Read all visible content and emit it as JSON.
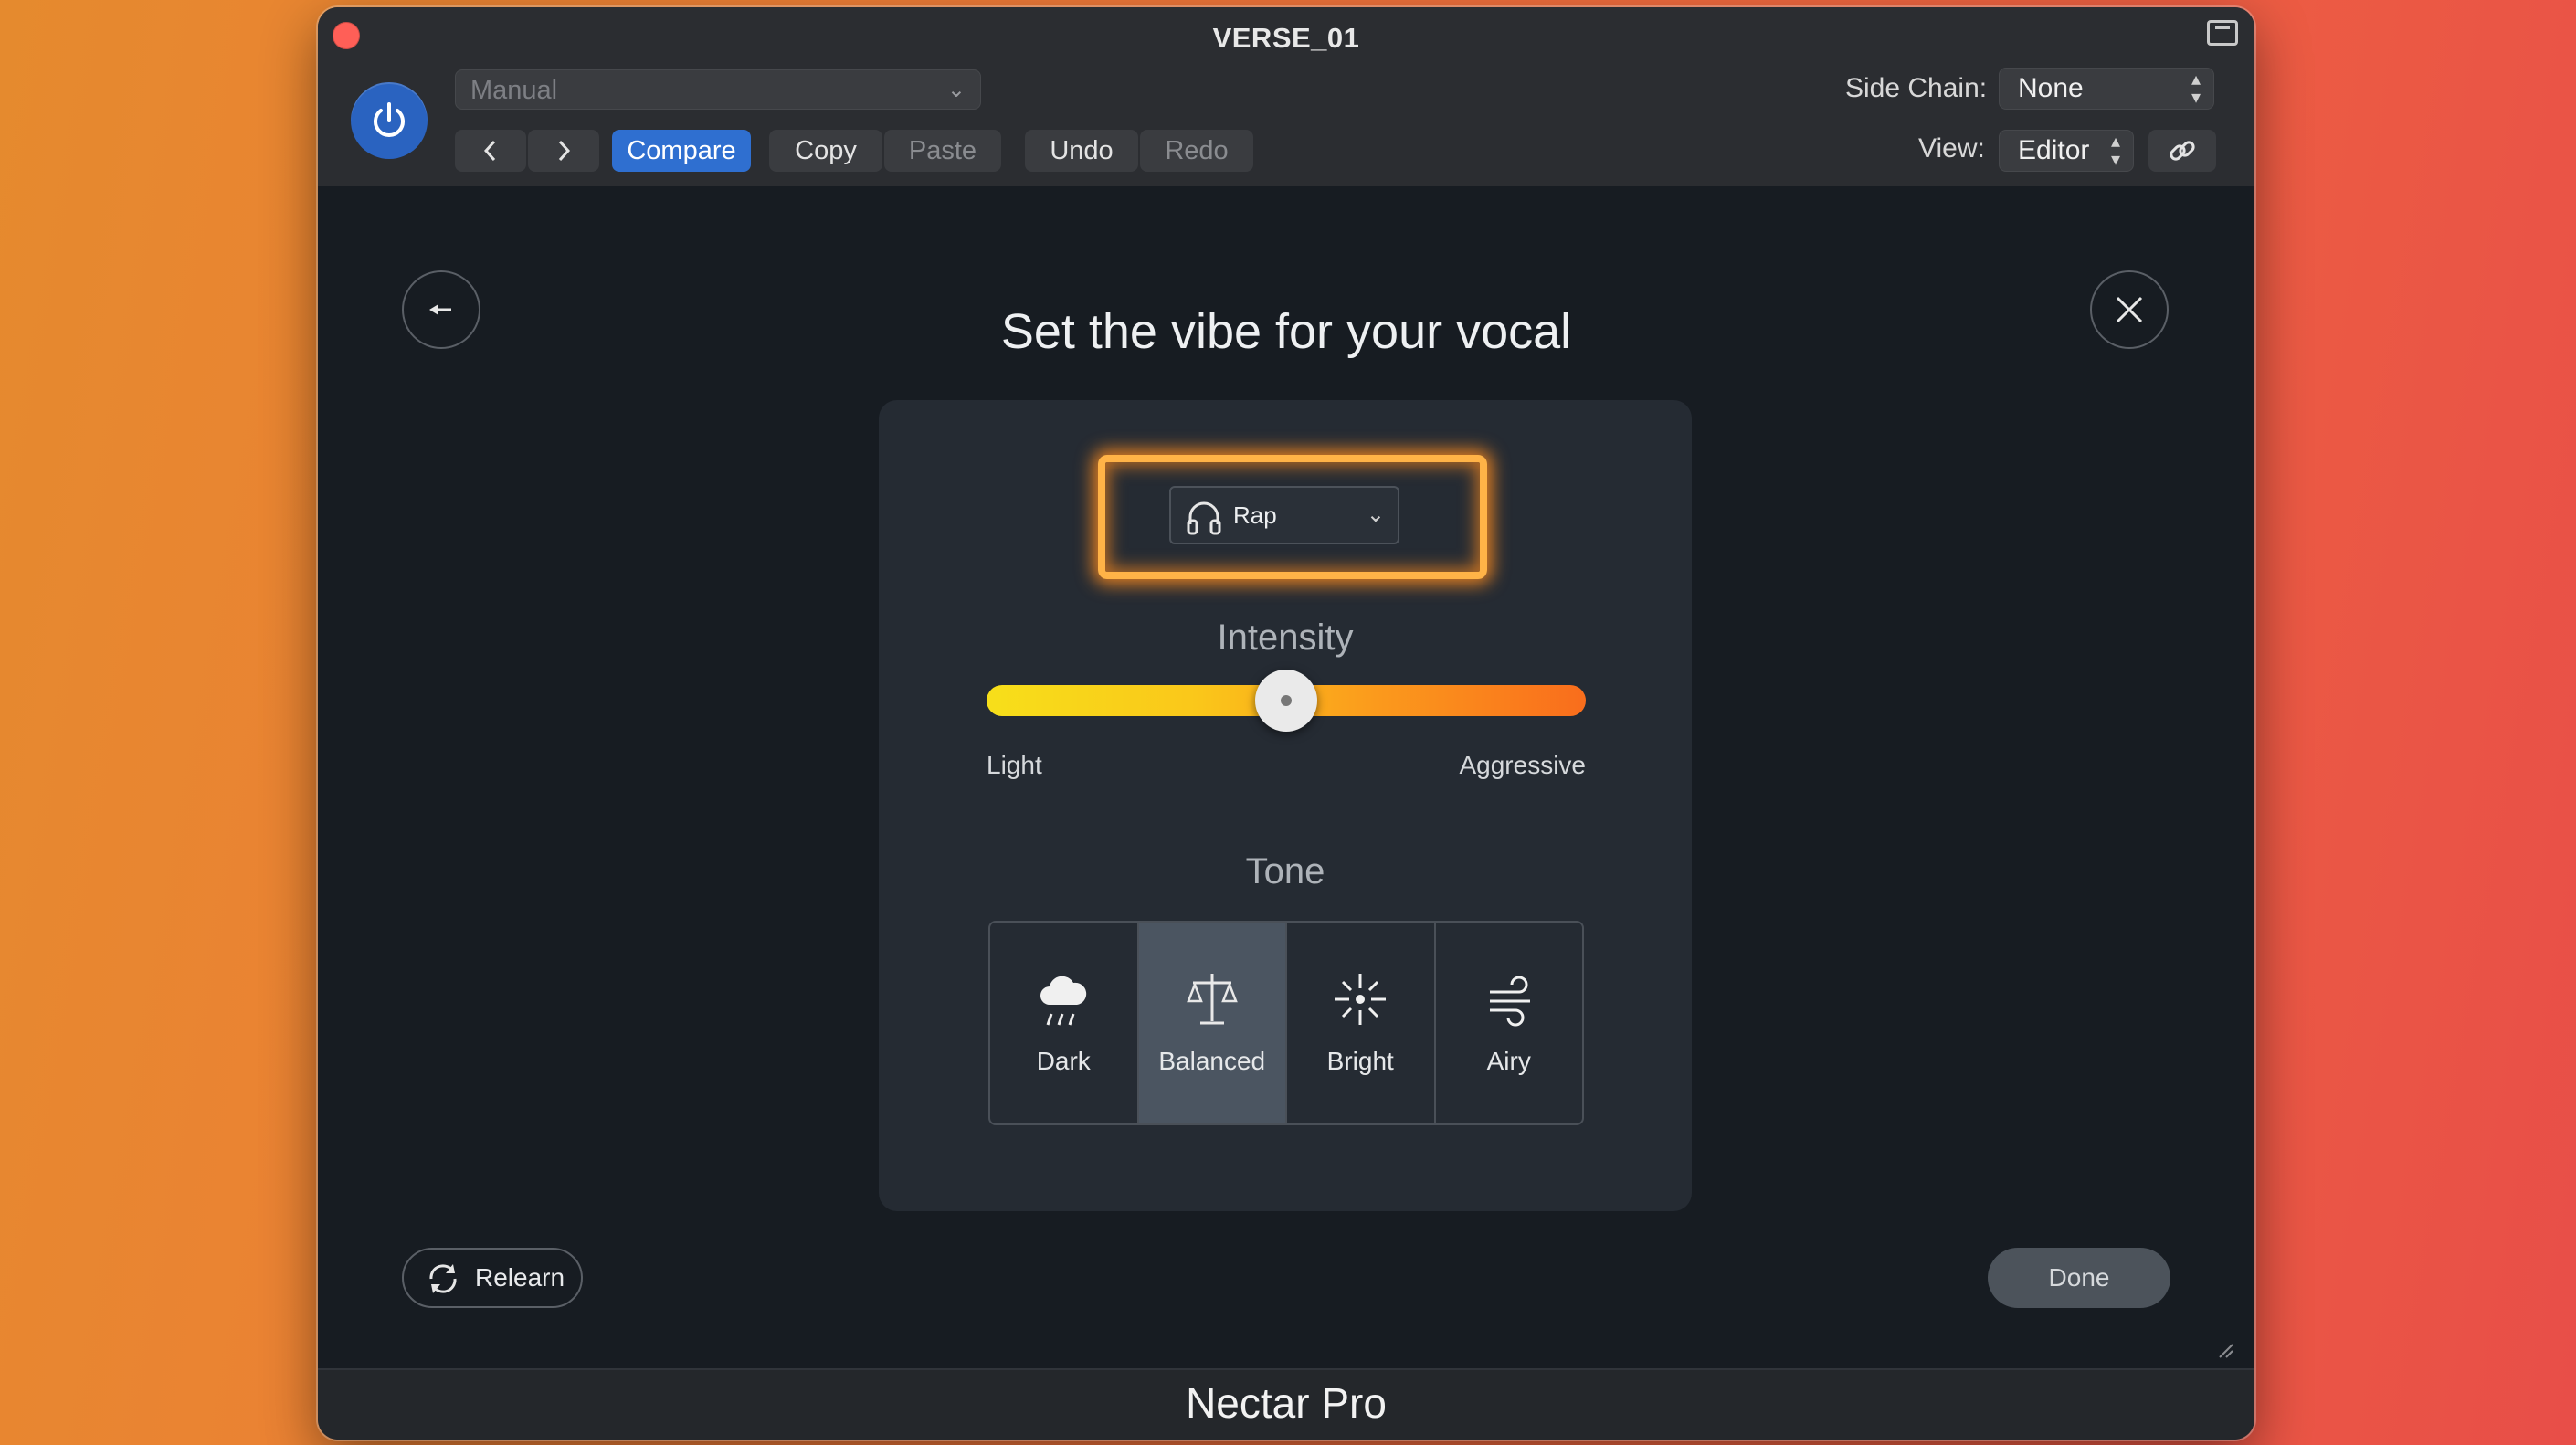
{
  "window": {
    "title": "VERSE_01",
    "product": "Nectar Pro"
  },
  "toolbar": {
    "preset_value": "Manual",
    "compare_label": "Compare",
    "copy_label": "Copy",
    "paste_label": "Paste",
    "undo_label": "Undo",
    "redo_label": "Redo",
    "sidechain_label": "Side Chain:",
    "sidechain_value": "None",
    "view_label": "View:",
    "view_value": "Editor"
  },
  "main": {
    "heading": "Set the vibe for your vocal",
    "genre_value": "Rap",
    "intensity": {
      "title": "Intensity",
      "min_label": "Light",
      "max_label": "Aggressive",
      "value": 0.5
    },
    "tone": {
      "title": "Tone",
      "options": [
        {
          "label": "Dark",
          "icon": "rain-cloud-icon",
          "selected": false
        },
        {
          "label": "Balanced",
          "icon": "scale-icon",
          "selected": true
        },
        {
          "label": "Bright",
          "icon": "sparkle-icon",
          "selected": false
        },
        {
          "label": "Airy",
          "icon": "wind-icon",
          "selected": false
        }
      ]
    },
    "relearn_label": "Relearn",
    "done_label": "Done"
  },
  "colors": {
    "accent_blue": "#2f6fd0",
    "glow_orange": "#ffb347",
    "close_red": "#ff5f57"
  }
}
